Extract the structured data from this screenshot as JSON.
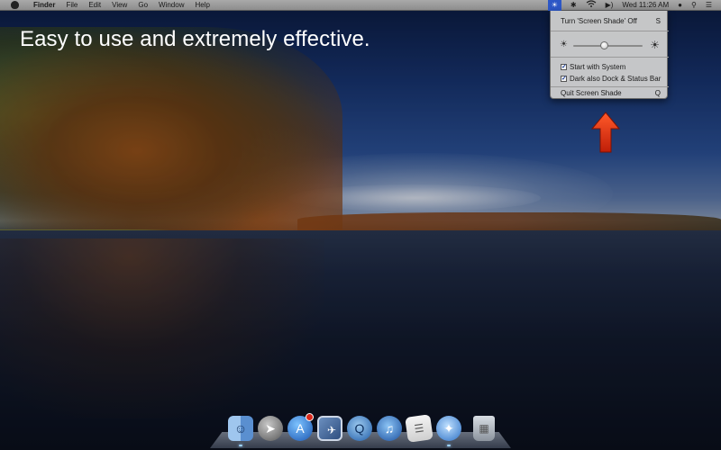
{
  "menubar": {
    "apple_icon": "apple-icon",
    "app_name": "Finder",
    "menus": [
      "File",
      "Edit",
      "View",
      "Go",
      "Window",
      "Help"
    ],
    "status_icons": [
      "screen-shade-icon",
      "bluetooth-icon",
      "wifi-icon",
      "volume-icon"
    ],
    "clock": "Wed 11:26 AM",
    "extra_icons": [
      "user-icon",
      "spotlight-search-icon",
      "notification-list-icon"
    ]
  },
  "headline": "Easy to use and extremely effective.",
  "dropdown": {
    "toggle_label": "Turn 'Screen Shade' Off",
    "toggle_shortcut": "S",
    "brightness": {
      "value": 0.45,
      "min_icon": "sun-small-icon",
      "max_icon": "sun-large-icon"
    },
    "start_with_system": {
      "label": "Start with System",
      "checked": true
    },
    "dark_dock": {
      "label": "Dark also Dock & Status Bar",
      "checked": true
    },
    "quit_label": "Quit Screen Shade",
    "quit_shortcut": "Q"
  },
  "dock": {
    "items": [
      {
        "name": "finder",
        "icon": "finder-icon",
        "running": true
      },
      {
        "name": "launchpad",
        "icon": "rocket-icon",
        "running": false
      },
      {
        "name": "app-store",
        "icon": "app-store-icon",
        "running": false,
        "badge": true
      },
      {
        "name": "preview",
        "icon": "preview-icon",
        "running": false
      },
      {
        "name": "quicktime",
        "icon": "quicktime-icon",
        "running": false
      },
      {
        "name": "itunes",
        "icon": "itunes-icon",
        "running": false
      },
      {
        "name": "textedit",
        "icon": "textedit-icon",
        "running": false
      },
      {
        "name": "safari",
        "icon": "safari-icon",
        "running": true
      },
      {
        "name": "trash",
        "icon": "trash-icon",
        "running": false
      }
    ]
  },
  "colors": {
    "menubar": "#9c9c9c",
    "highlight": "#2d57c6",
    "arrow": "#e8381a"
  }
}
